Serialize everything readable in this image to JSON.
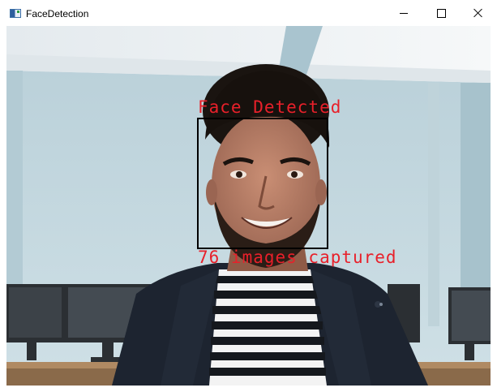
{
  "window": {
    "title": "FaceDetection",
    "icon": "app-window-icon",
    "controls": {
      "minimize_icon": "minimize-icon",
      "maximize_icon": "maximize-icon",
      "close_icon": "close-icon"
    }
  },
  "camera": {
    "face_label": "Face Detected",
    "count_label": "76 images captured",
    "overlay_color": "#e8202a",
    "box_color": "#000000"
  }
}
